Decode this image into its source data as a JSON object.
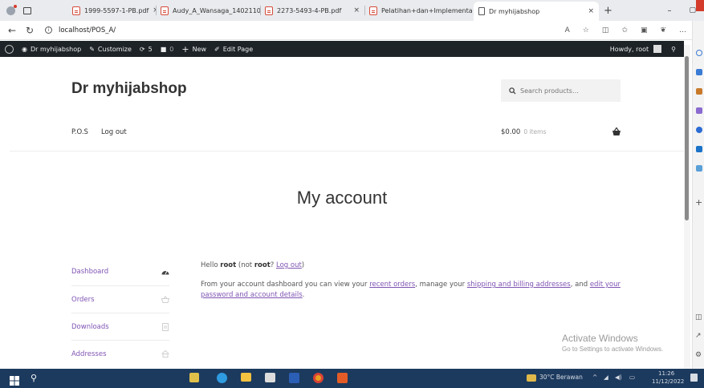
{
  "browser": {
    "tabs": [
      {
        "title": "1999-5597-1-PB.pdf",
        "type": "pdf"
      },
      {
        "title": "Audy_A_Wansaga_1402110",
        "type": "pdf"
      },
      {
        "title": "2273-5493-4-PB.pdf",
        "type": "pdf"
      },
      {
        "title": "Pelatihan+dan+Implementa",
        "type": "pdf"
      },
      {
        "title": "Dr myhijabshop",
        "type": "page",
        "active": true
      }
    ],
    "close_glyph": "×",
    "new_tab_glyph": "+",
    "address": "localhost/POS_A/"
  },
  "admin_bar": {
    "site_name": "Dr myhijabshop",
    "customize": "Customize",
    "updates_count": "5",
    "comments_count": "0",
    "new_label": "New",
    "edit_page": "Edit Page",
    "howdy": "Howdy, root"
  },
  "site": {
    "title": "Dr myhijabshop",
    "search_placeholder": "Search products…",
    "menu": [
      "P.O.S",
      "Log out"
    ],
    "cart_total": "$0.00",
    "cart_count": "0 items"
  },
  "page": {
    "title": "My account"
  },
  "account_nav": [
    {
      "label": "Dashboard",
      "icon": "dashboard-icon"
    },
    {
      "label": "Orders",
      "icon": "basket-icon"
    },
    {
      "label": "Downloads",
      "icon": "file-icon"
    },
    {
      "label": "Addresses",
      "icon": "home-icon"
    }
  ],
  "dashboard": {
    "hello_prefix": "Hello ",
    "user": "root",
    "not_prefix": " (not ",
    "not_user": "root",
    "not_suffix": "? ",
    "logout_link": "Log out",
    "close_paren": ")",
    "intro_1": "From your account dashboard you can view your ",
    "link_orders": "recent orders",
    "intro_2": ", manage your ",
    "link_addresses": "shipping and billing addresses",
    "intro_3": ", and ",
    "link_account": "edit your password and account details",
    "intro_4": "."
  },
  "watermark": {
    "title": "Activate Windows",
    "subtitle": "Go to Settings to activate Windows."
  },
  "taskbar": {
    "weather": "30°C  Berawan",
    "time": "11:26",
    "date": "11/12/2022"
  },
  "colors": {
    "accent": "#7f54b3",
    "admin_bar": "#1d2327",
    "taskbar": "#1c3a5e"
  }
}
